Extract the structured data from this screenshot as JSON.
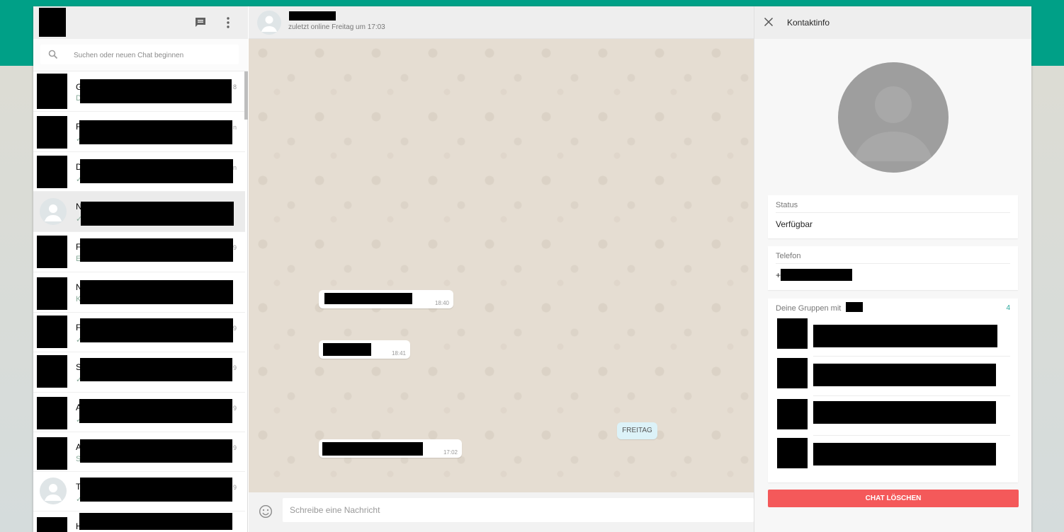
{
  "colors": {
    "accent_band": "#00a087",
    "delete_button": "#f4595a",
    "group_count": "#26a69a"
  },
  "left_panel": {
    "header_icons": [
      "chat-icon",
      "menu-icon"
    ],
    "search": {
      "placeholder": "Suchen oder neuen Chat beginnen",
      "value": ""
    },
    "chats": [
      {
        "initial": "G",
        "sub": "D",
        "time": "8"
      },
      {
        "initial": "F",
        "sub": "✓",
        "time": "n"
      },
      {
        "initial": "D",
        "sub": "✓",
        "time": "n"
      },
      {
        "initial": "N",
        "sub": "✓",
        "time": ""
      },
      {
        "initial": "F",
        "sub": "E",
        "time": "9"
      },
      {
        "initial": "N",
        "sub": "K",
        "time": ""
      },
      {
        "initial": "F",
        "sub": "✓",
        "time": "9"
      },
      {
        "initial": "S",
        "sub": "✓",
        "time": "9"
      },
      {
        "initial": "A",
        "sub": "✓",
        "time": "9"
      },
      {
        "initial": "A",
        "sub": "S",
        "time": "9"
      },
      {
        "initial": "T",
        "sub": "✓",
        "time": "9"
      },
      {
        "initial": "H",
        "sub": "",
        "time": ""
      }
    ]
  },
  "conversation": {
    "last_seen": "zuletzt online Freitag um 17:03",
    "messages": [
      {
        "time": "18:40"
      },
      {
        "time": "18:41"
      },
      {
        "time": "17:02"
      }
    ],
    "day_divider": "FREITAG",
    "composer_placeholder": "Schreibe eine Nachricht"
  },
  "contact_info": {
    "title": "Kontaktinfo",
    "status_label": "Status",
    "status_value": "Verfügbar",
    "phone_label": "Telefon",
    "phone_prefix": "+",
    "groups_label": "Deine Gruppen mit",
    "groups_count": "4",
    "delete_label": "CHAT LÖSCHEN"
  }
}
